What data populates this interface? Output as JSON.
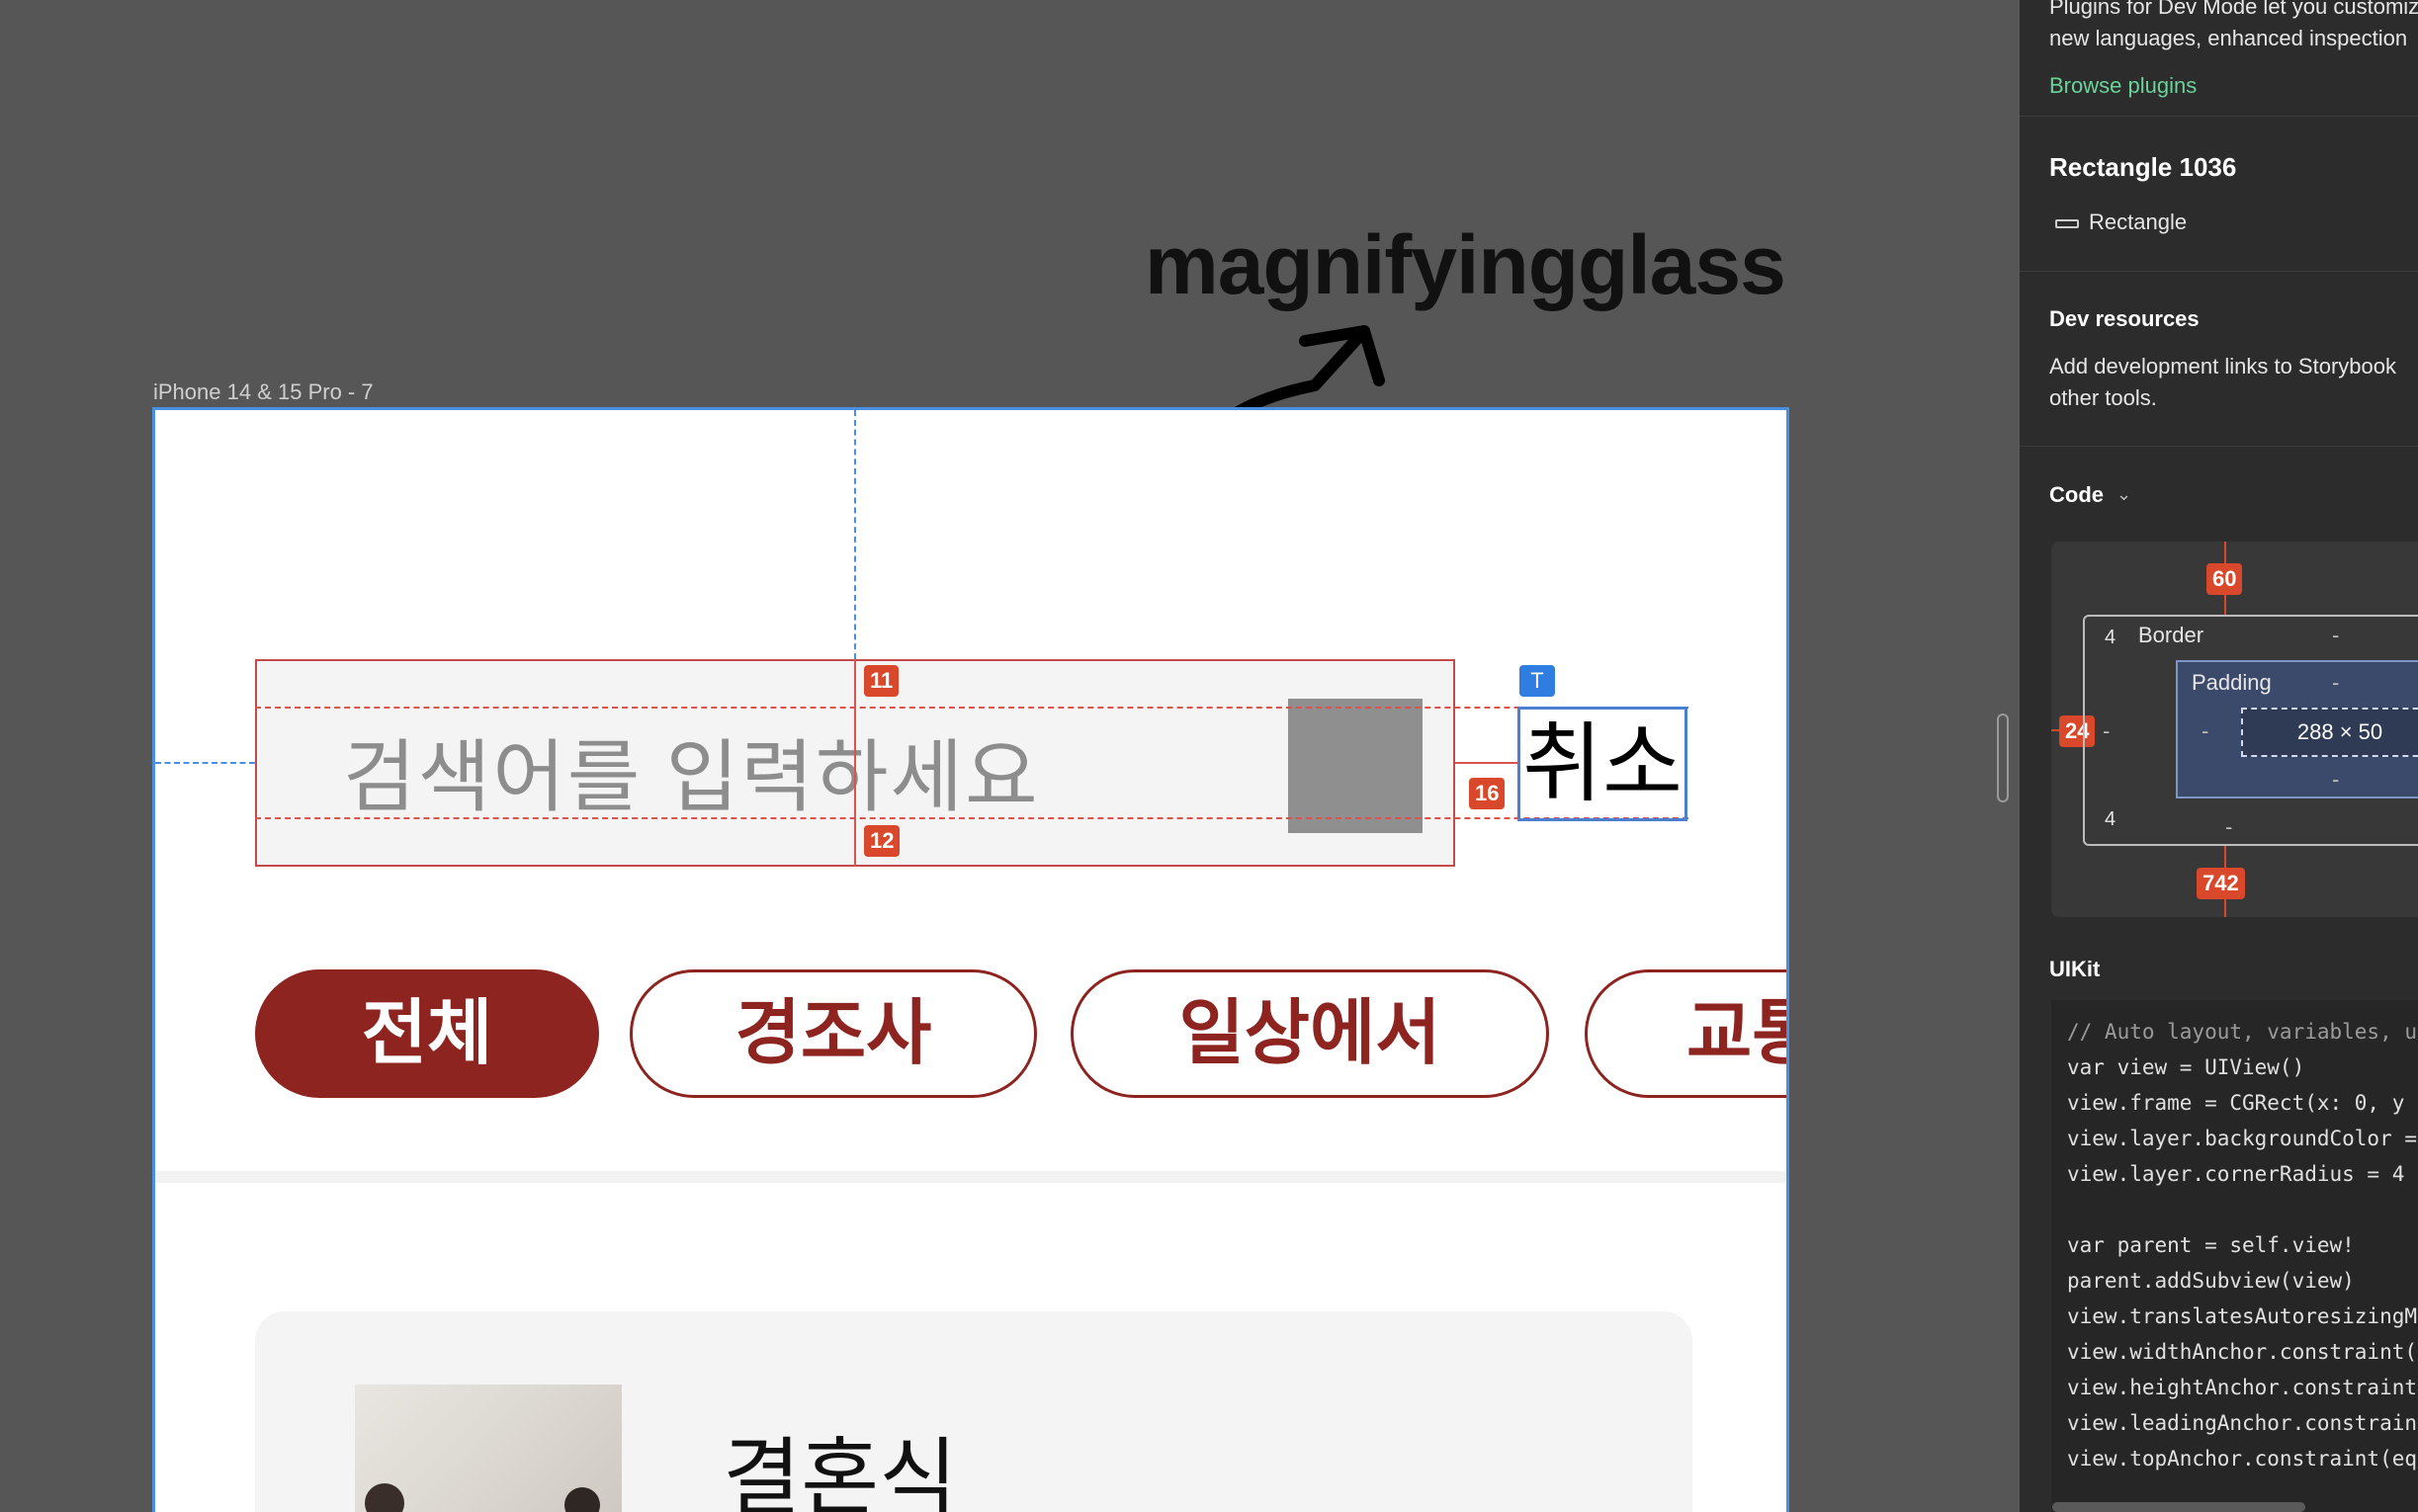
{
  "canvas": {
    "frame_label": "iPhone 14 & 15 Pro - 7",
    "annotation_text": "magnifyingglass",
    "search": {
      "placeholder": "검색어를 입력하세요",
      "cancel_label": "취소"
    },
    "measurements": {
      "top": "11",
      "bottom": "12",
      "gap": "16",
      "text_badge": "T"
    },
    "chips": [
      {
        "label": "전체",
        "active": true
      },
      {
        "label": "경조사",
        "active": false
      },
      {
        "label": "일상에서",
        "active": false
      },
      {
        "label": "교통",
        "active": false
      }
    ],
    "card": {
      "title": "결혼식"
    },
    "colors": {
      "brand": "#8d2420",
      "guide": "#d9534f",
      "frame_border": "#4a90e2"
    }
  },
  "panel": {
    "plugins_text_line1": "Plugins for Dev Mode let you customize",
    "plugins_text_line2": "new languages, enhanced inspection",
    "browse_plugins": "Browse plugins",
    "layer_name": "Rectangle 1036",
    "layer_type": "Rectangle",
    "dev_resources_title": "Dev resources",
    "dev_resources_line1": "Add development links to Storybook",
    "dev_resources_line2": "other tools.",
    "code_title": "Code",
    "box_model": {
      "top": "60",
      "left": "24",
      "bottom": "742",
      "border_label": "Border",
      "border_value": "-",
      "border_top": "4",
      "border_bottom": "4",
      "border_left": "-",
      "padding_label": "Padding",
      "padding_value": "-",
      "padding_left": "-",
      "padding_bottom": "-",
      "outer_bottom": "-",
      "size": "288 × 50"
    },
    "uikit_title": "UIKit",
    "code_lines": [
      "// Auto layout, variables, u",
      "var view = UIView()",
      "view.frame = CGRect(x: 0, y",
      "view.layer.backgroundColor =",
      "view.layer.cornerRadius = 4",
      "",
      "var parent = self.view!",
      "parent.addSubview(view)",
      "view.translatesAutoresizingM",
      "view.widthAnchor.constraint(",
      "view.heightAnchor.constraint",
      "view.leadingAnchor.constrain",
      "view.topAnchor.constraint(eq"
    ]
  }
}
